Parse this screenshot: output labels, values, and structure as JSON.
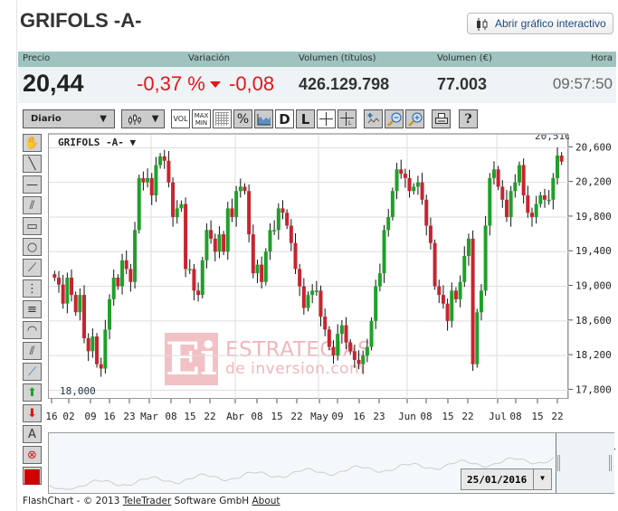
{
  "header": {
    "title": "GRIFOLS -A-",
    "open_chart_button": "Abrir gráfico interactivo"
  },
  "quote": {
    "labels": {
      "price": "Precio",
      "change": "Variación",
      "volume_shares": "Volumen (títulos)",
      "volume_eur": "Volumen (€)",
      "time": "Hora"
    },
    "price": "20,44",
    "change_pct": "-0,37 %",
    "change_abs": "-0,08",
    "volume_shares": "426.129.798",
    "volume_eur": "77.003",
    "time": "09:57:50",
    "colors": {
      "negative": "#e8141b",
      "header_bg": "#9fc3bf",
      "row_bg": "#eef4f6"
    }
  },
  "toolbar": {
    "period": "Diario",
    "chart_type_icon": "candlestick-icon",
    "vol": "VOL",
    "maxmin_top": "MAX",
    "maxmin_bottom": "MIN",
    "pct": "%",
    "d": "D",
    "l": "L",
    "help": "?"
  },
  "left_tools": [
    "hand-icon",
    "line-icon",
    "horizontal-line-icon",
    "parallel-lines-icon",
    "rectangle-icon",
    "circle-icon",
    "fan-icon",
    "fibonacci-vertical-icon",
    "fibonacci-horizontal-icon",
    "arc-icon",
    "parallel-channel-icon",
    "regression-icon",
    "arrow-up-icon",
    "arrow-down-icon",
    "text-icon",
    "delete-icon",
    "color-picker-icon"
  ],
  "left_text_tool": "A",
  "chart_data": {
    "type": "candlestick",
    "instrument_label": "GRIFOLS -A-",
    "ylim": [
      17700,
      20750
    ],
    "y_ticks": [
      "20,600",
      "20,200",
      "19,800",
      "19,400",
      "19,000",
      "18,600",
      "18,200",
      "17,800"
    ],
    "y_tick_values": [
      20600,
      20200,
      19800,
      19400,
      19000,
      18600,
      18200,
      17800
    ],
    "x_ticks": [
      "16",
      "02",
      "09",
      "16",
      "23",
      "Mar",
      "08",
      "15",
      "22",
      "Abr",
      "08",
      "15",
      "22",
      "May",
      "09",
      "16",
      "23",
      "Jun",
      "08",
      "15",
      "22",
      "Jul",
      "08",
      "15",
      "22"
    ],
    "max_label": "20,510",
    "min_label": "18,000",
    "up_color": "#1fa02a",
    "down_color": "#c8242f",
    "closes": [
      19100,
      19020,
      18800,
      19100,
      18900,
      18700,
      18900,
      18400,
      18250,
      18420,
      18100,
      18050,
      18500,
      18850,
      19100,
      19000,
      19300,
      19200,
      19050,
      19650,
      20250,
      20200,
      20250,
      20050,
      20400,
      20500,
      20450,
      20200,
      19800,
      19900,
      19950,
      19200,
      19200,
      18950,
      18900,
      19300,
      19650,
      19550,
      19400,
      19600,
      19400,
      19900,
      19800,
      20100,
      20150,
      20100,
      19600,
      19150,
      19250,
      19050,
      19400,
      19650,
      19650,
      19900,
      19850,
      19700,
      19500,
      19200,
      19000,
      18750,
      18900,
      18950,
      18950,
      18650,
      18500,
      18300,
      18200,
      18450,
      18550,
      18350,
      18250,
      18150,
      18100,
      18200,
      18300,
      18600,
      19000,
      19150,
      19650,
      19800,
      20100,
      20350,
      20300,
      20250,
      20100,
      20150,
      20200,
      20000,
      19700,
      19500,
      19000,
      18900,
      18800,
      18600,
      18950,
      18850,
      19050,
      19350,
      19550,
      18100,
      18700,
      18950,
      19700,
      20250,
      20350,
      20150,
      20000,
      19800,
      20100,
      20200,
      20400,
      20050,
      19850,
      19800,
      19950,
      20050,
      20000,
      20000,
      20250,
      20510,
      20440
    ]
  },
  "navigator": {
    "date": "25/01/2016"
  },
  "watermark": {
    "logo": "Ei",
    "line1": "ESTRATEGIAS",
    "line2": "de inversion.com"
  },
  "footer": {
    "prefix": "FlashChart - © 2013 ",
    "link1": "TeleTrader",
    "middle": " Software GmbH ",
    "link2": "About"
  }
}
